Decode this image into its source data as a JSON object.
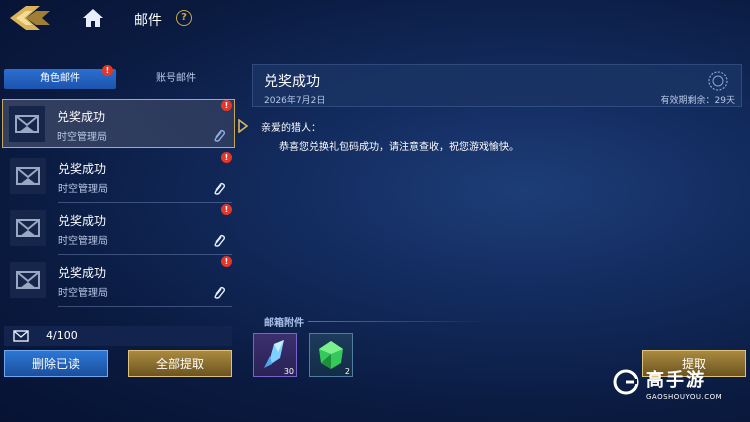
{
  "header": {
    "title": "邮件",
    "help": "?"
  },
  "tabs": [
    {
      "label": "角色邮件",
      "active": true,
      "badge": "!"
    },
    {
      "label": "账号邮件",
      "active": false
    }
  ],
  "mails": [
    {
      "title": "兑奖成功",
      "sender": "时空管理局",
      "selected": true,
      "unread_badge": "!"
    },
    {
      "title": "兑奖成功",
      "sender": "时空管理局",
      "selected": false,
      "unread_badge": "!"
    },
    {
      "title": "兑奖成功",
      "sender": "时空管理局",
      "selected": false,
      "unread_badge": "!"
    },
    {
      "title": "兑奖成功",
      "sender": "时空管理局",
      "selected": false,
      "unread_badge": "!"
    }
  ],
  "mailbox": {
    "count": "4/100"
  },
  "buttons": {
    "delete_read": "删除已读",
    "claim_all": "全部提取",
    "claim": "提取"
  },
  "detail": {
    "title": "兑奖成功",
    "date": "2026年7月2日",
    "expire": "有效期剩余：29天",
    "greeting": "亲爱的猎人：",
    "body": "恭喜您兑换礼包码成功，请注意查收，祝您游戏愉快。"
  },
  "attachments": {
    "label": "邮箱附件",
    "items": [
      {
        "icon": "blue-crystal-icon",
        "qty": "30"
      },
      {
        "icon": "green-gem-icon",
        "qty": "2"
      }
    ]
  },
  "watermark": {
    "brand": "高手游",
    "url": "GAOSHOUYOU.COM"
  },
  "colors": {
    "accent_gold": "#c7a85a",
    "badge_red": "#e0392b",
    "tab_blue": "#2b6fd0"
  }
}
